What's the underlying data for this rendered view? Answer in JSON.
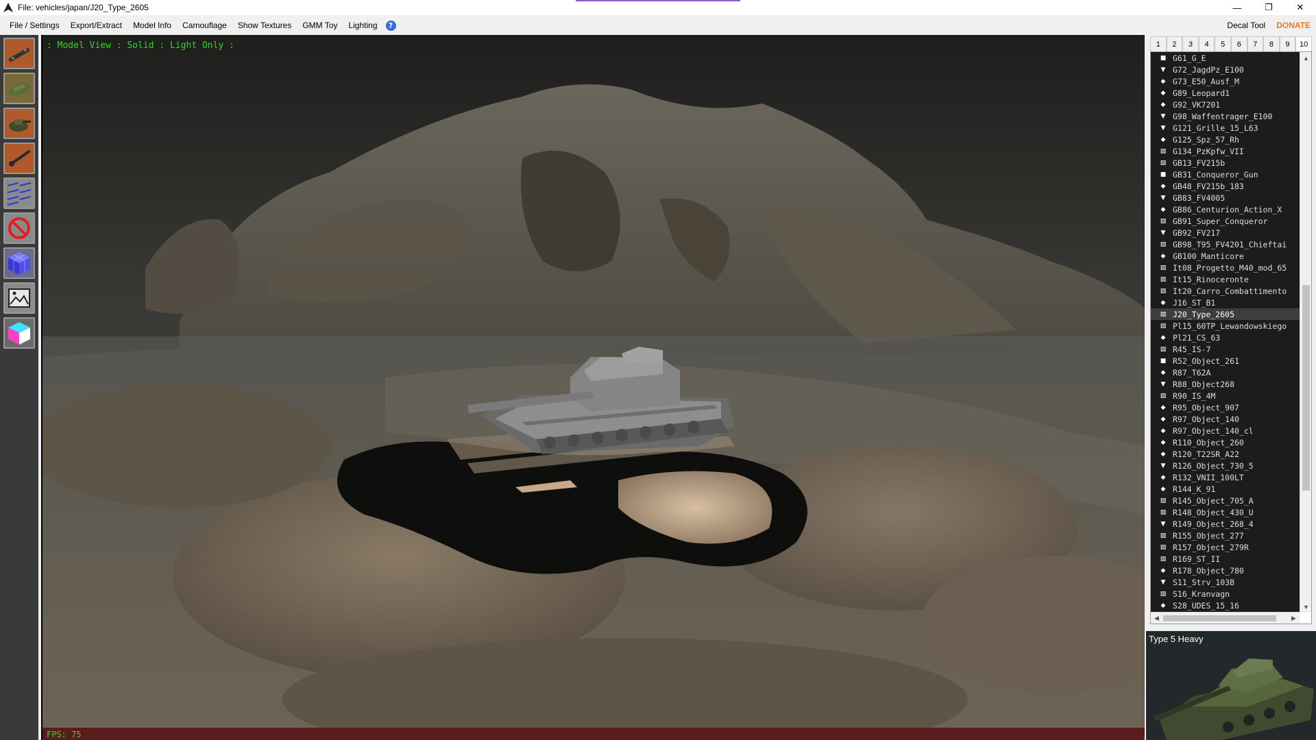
{
  "window": {
    "title": "File: vehicles/japan/J20_Type_2605",
    "minimize_glyph": "—",
    "maximize_glyph": "❐",
    "close_glyph": "✕"
  },
  "menu": {
    "items": [
      "File / Settings",
      "Export/Extract",
      "Model Info",
      "Camouflage",
      "Show Textures",
      "GMM Toy",
      "Lighting"
    ],
    "help_glyph": "?",
    "decal_tool": "Decal Tool",
    "donate": "DONATE"
  },
  "toolbar": {
    "icons": [
      "chassis-icon",
      "hull-icon",
      "turret-icon",
      "gun-icon",
      "grid-icon",
      "no-camo-icon",
      "cube-texture-icon",
      "image-icon",
      "color-cube-icon"
    ]
  },
  "viewport": {
    "status": ": Model View : Solid : Light Only :",
    "fps": "FPS: 75"
  },
  "tabs": {
    "labels": [
      "1",
      "2",
      "3",
      "4",
      "5",
      "6",
      "7",
      "8",
      "9",
      "10"
    ],
    "active": "10"
  },
  "vehicle_list": {
    "selected": "J20_Type_2605",
    "items": [
      {
        "icon": "square",
        "label": "G61_G_E"
      },
      {
        "icon": "triangle",
        "label": "G72_JagdPz_E100"
      },
      {
        "icon": "diamond",
        "label": "G73_E50_Ausf_M"
      },
      {
        "icon": "diamond",
        "label": "G89_Leopard1"
      },
      {
        "icon": "diamond",
        "label": "G92_VK7201"
      },
      {
        "icon": "triangle",
        "label": "G98_Waffentrager_E100"
      },
      {
        "icon": "triangle",
        "label": "G121_Grille_15_L63"
      },
      {
        "icon": "diamond",
        "label": "G125_Spz_57_Rh"
      },
      {
        "icon": "stripes",
        "label": "G134_PzKpfw_VII"
      },
      {
        "icon": "stripes",
        "label": "GB13_FV215b"
      },
      {
        "icon": "square",
        "label": "GB31_Conqueror_Gun"
      },
      {
        "icon": "diamond",
        "label": "GB48_FV215b_183"
      },
      {
        "icon": "triangle",
        "label": "GB83_FV4005"
      },
      {
        "icon": "diamond",
        "label": "GB86_Centurion_Action_X"
      },
      {
        "icon": "stripes",
        "label": "GB91_Super_Conqueror"
      },
      {
        "icon": "triangle",
        "label": "GB92_FV217"
      },
      {
        "icon": "stripes",
        "label": "GB98_T95_FV4201_Chieftai"
      },
      {
        "icon": "diamond",
        "label": "GB100_Manticore"
      },
      {
        "icon": "stripes",
        "label": "It08_Progetto_M40_mod_65"
      },
      {
        "icon": "stripes",
        "label": "It15_Rinoceronte"
      },
      {
        "icon": "stripes",
        "label": "It20_Carro_Combattimento"
      },
      {
        "icon": "diamond",
        "label": "J16_ST_B1"
      },
      {
        "icon": "stripes",
        "label": "J20_Type_2605"
      },
      {
        "icon": "stripes",
        "label": "Pl15_60TP_Lewandowskiego"
      },
      {
        "icon": "diamond",
        "label": "Pl21_CS_63"
      },
      {
        "icon": "stripes",
        "label": "R45_IS-7"
      },
      {
        "icon": "square",
        "label": "R52_Object_261"
      },
      {
        "icon": "diamond",
        "label": "R87_T62A"
      },
      {
        "icon": "triangle",
        "label": "R88_Object268"
      },
      {
        "icon": "stripes",
        "label": "R90_IS_4M"
      },
      {
        "icon": "diamond",
        "label": "R95_Object_907"
      },
      {
        "icon": "diamond",
        "label": "R97_Object_140"
      },
      {
        "icon": "diamond",
        "label": "R97_Object_140_cl"
      },
      {
        "icon": "diamond",
        "label": "R110_Object_260"
      },
      {
        "icon": "diamond",
        "label": "R120_T22SR_A22"
      },
      {
        "icon": "triangle",
        "label": "R126_Object_730_5"
      },
      {
        "icon": "diamond",
        "label": "R132_VNII_100LT"
      },
      {
        "icon": "diamond",
        "label": "R144_K_91"
      },
      {
        "icon": "stripes",
        "label": "R145_Object_705_A"
      },
      {
        "icon": "stripes",
        "label": "R148_Object_430_U"
      },
      {
        "icon": "triangle",
        "label": "R149_Object_268_4"
      },
      {
        "icon": "stripes",
        "label": "R155_Object_277"
      },
      {
        "icon": "stripes",
        "label": "R157_Object_279R"
      },
      {
        "icon": "stripes",
        "label": "R169_ST_II"
      },
      {
        "icon": "diamond",
        "label": "R178_Object_780"
      },
      {
        "icon": "triangle",
        "label": "S11_Strv_103B"
      },
      {
        "icon": "stripes",
        "label": "S16_Kranvagn"
      },
      {
        "icon": "diamond",
        "label": "S28_UDES_15_16"
      }
    ]
  },
  "preview": {
    "title": "Type 5 Heavy"
  },
  "colors": {
    "accent_green": "#2fd82f",
    "donate_orange": "#e87d1e",
    "help_blue": "#2f6fd6"
  }
}
